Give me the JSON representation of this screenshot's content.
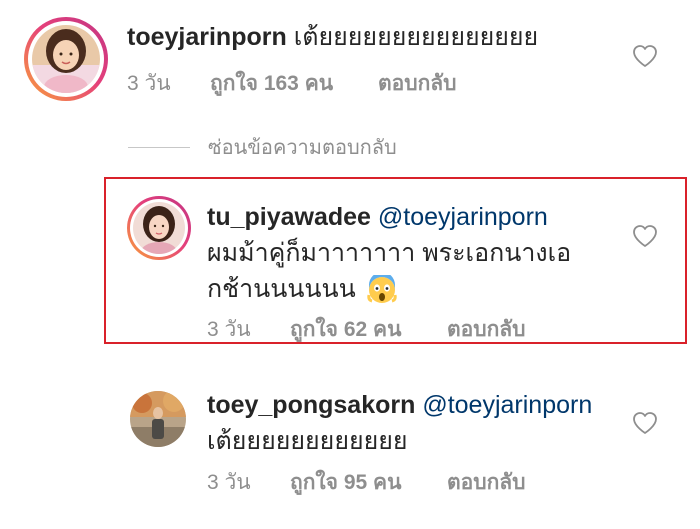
{
  "comments": [
    {
      "username": "toeyjarinporn",
      "text": "เต้ยยยยยยยยยยยยยยย",
      "time": "3 วัน",
      "likes": "ถูกใจ 163 คน",
      "reply": "ตอบกลับ",
      "avatar_icon": "portrait-avatar-icon"
    },
    {
      "username": "tu_piyawadee",
      "mention": "@toeyjarinporn",
      "text_line1": "ผมม้าคู่ก็มาาาาาาา พระเอกนางเอ",
      "text_line2": "กช้านนนนนน",
      "emoji": "screaming-face-emoji",
      "time": "3 วัน",
      "likes": "ถูกใจ 62 คน",
      "reply": "ตอบกลับ",
      "avatar_icon": "portrait-avatar-icon"
    },
    {
      "username": "toey_pongsakorn",
      "mention": "@toeyjarinporn",
      "text": "เต้ยยยยยยยยยยยย",
      "time": "3 วัน",
      "likes": "ถูกใจ 95 คน",
      "reply": "ตอบกลับ",
      "avatar_icon": "portrait-avatar-icon"
    }
  ],
  "hide_replies_label": "ซ่อนข้อความตอบกลับ",
  "colors": {
    "highlight_border": "#d9212a",
    "mention": "#00376b",
    "meta": "#8e8e8e"
  }
}
